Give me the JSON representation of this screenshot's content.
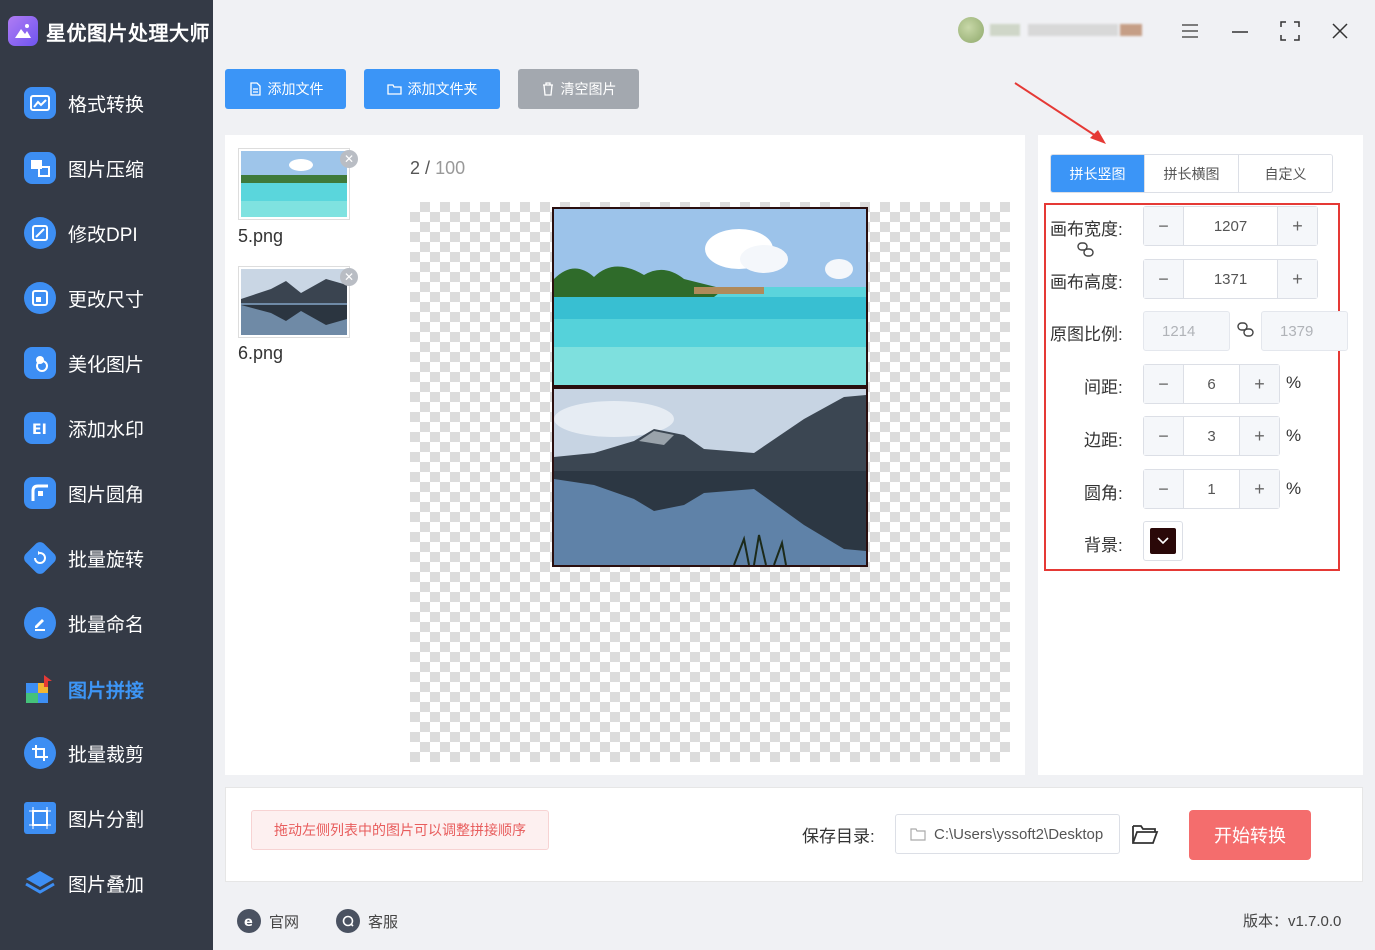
{
  "app": {
    "title": "星优图片处理大师"
  },
  "sidebar": {
    "items": [
      {
        "label": "格式转换",
        "icon": "format-convert-icon",
        "color": "#3d8ef3"
      },
      {
        "label": "图片压缩",
        "icon": "compress-icon",
        "color": "#3d8ef3"
      },
      {
        "label": "修改DPI",
        "icon": "dpi-icon",
        "color": "#3d8ef3"
      },
      {
        "label": "更改尺寸",
        "icon": "resize-icon",
        "color": "#3d8ef3"
      },
      {
        "label": "美化图片",
        "icon": "beautify-icon",
        "color": "#3d8ef3"
      },
      {
        "label": "添加水印",
        "icon": "watermark-icon",
        "color": "#3d8ef3"
      },
      {
        "label": "图片圆角",
        "icon": "rounded-corner-icon",
        "color": "#3d8ef3"
      },
      {
        "label": "批量旋转",
        "icon": "rotate-icon",
        "color": "#3d8ef3"
      },
      {
        "label": "批量命名",
        "icon": "rename-icon",
        "color": "#3d8ef3"
      },
      {
        "label": "图片拼接",
        "icon": "puzzle-icon",
        "color": "#3d8ef3",
        "active": true
      },
      {
        "label": "批量裁剪",
        "icon": "crop-icon",
        "color": "#3d8ef3"
      },
      {
        "label": "图片分割",
        "icon": "split-icon",
        "color": "#3d8ef3"
      },
      {
        "label": "图片叠加",
        "icon": "layers-icon",
        "color": "#3d8ef3"
      }
    ]
  },
  "toolbar": {
    "add_file": "添加文件",
    "add_folder": "添加文件夹",
    "clear": "清空图片"
  },
  "files": [
    {
      "name": "5.png"
    },
    {
      "name": "6.png"
    }
  ],
  "preview": {
    "current": "2",
    "separator": "/",
    "total": "100"
  },
  "tabs": [
    {
      "label": "拼长竖图",
      "active": true
    },
    {
      "label": "拼长横图"
    },
    {
      "label": "自定义"
    }
  ],
  "settings": {
    "canvas_width_label": "画布宽度:",
    "canvas_width": "1207",
    "canvas_height_label": "画布高度:",
    "canvas_height": "1371",
    "ratio_label": "原图比例:",
    "ratio_width": "1214",
    "ratio_height": "1379",
    "gap_label": "间距:",
    "gap": "6",
    "margin_label": "边距:",
    "margin": "3",
    "radius_label": "圆角:",
    "radius": "1",
    "unit": "%",
    "background_label": "背景:",
    "background_color": "#2a0808"
  },
  "bottom": {
    "tip": "拖动左侧列表中的图片可以调整拼接顺序",
    "save_label": "保存目录:",
    "save_path": "C:\\Users\\yssoft2\\Desktop",
    "start": "开始转换"
  },
  "footer": {
    "website": "官网",
    "support": "客服",
    "version": "版本：v1.7.0.0"
  },
  "colors": {
    "accent": "#3b95f7",
    "sidebar_bg": "#343a46",
    "start_button": "#f46d6d",
    "highlight_box": "#e53935"
  }
}
